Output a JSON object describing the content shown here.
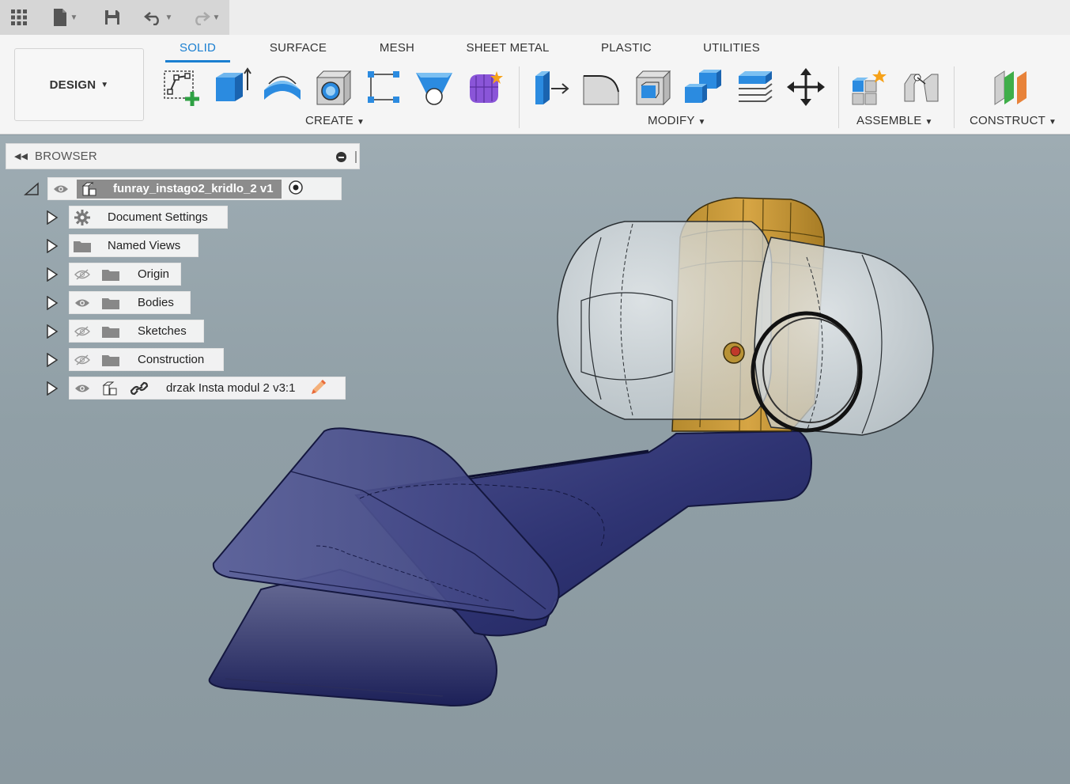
{
  "ribbon": {
    "design_label": "DESIGN",
    "tabs": [
      {
        "label": "SOLID",
        "active": true
      },
      {
        "label": "SURFACE",
        "active": false
      },
      {
        "label": "MESH",
        "active": false
      },
      {
        "label": "SHEET METAL",
        "active": false
      },
      {
        "label": "PLASTIC",
        "active": false
      },
      {
        "label": "UTILITIES",
        "active": false
      }
    ],
    "groups": {
      "create": "CREATE",
      "modify": "MODIFY",
      "assemble": "ASSEMBLE",
      "construct": "CONSTRUCT"
    },
    "accent_color": "#1a7fd1"
  },
  "browser": {
    "title": "BROWSER",
    "root": {
      "label": "funray_instago2_kridlo_2 v1"
    },
    "items": [
      {
        "label": "Document Settings"
      },
      {
        "label": "Named Views"
      },
      {
        "label": "Origin"
      },
      {
        "label": "Bodies"
      },
      {
        "label": "Sketches"
      },
      {
        "label": "Construction"
      },
      {
        "label": "drzak Insta modul 2 v3:1"
      }
    ]
  }
}
